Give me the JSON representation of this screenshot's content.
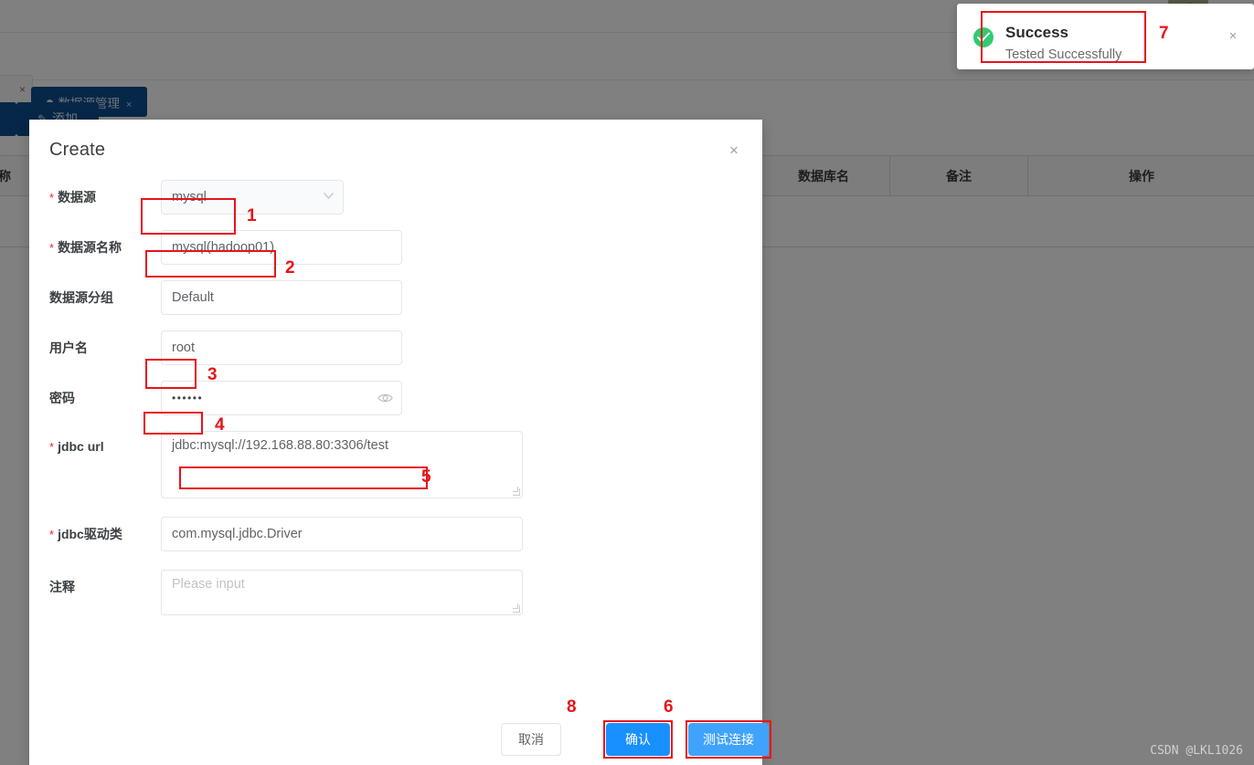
{
  "background": {
    "tab_partial_close": "×",
    "active_tab": {
      "label": "数据源管理",
      "close": "×"
    },
    "add_button": {
      "icon": "pencil-icon",
      "label": "添加"
    },
    "table": {
      "headers": [
        "称",
        "数据库名",
        "备注",
        "操作"
      ]
    }
  },
  "dialog": {
    "title": "Create",
    "close_icon": "×",
    "fields": [
      {
        "label": "数据源",
        "required": true,
        "type": "select",
        "value": "mysql",
        "icon": "chevron-down-icon"
      },
      {
        "label": "数据源名称",
        "required": true,
        "type": "text",
        "value": "mysql(hadoop01)"
      },
      {
        "label": "数据源分组",
        "required": false,
        "type": "text",
        "value": "Default"
      },
      {
        "label": "用户名",
        "required": false,
        "type": "text",
        "value": "root"
      },
      {
        "label": "密码",
        "required": false,
        "type": "password",
        "value": "••••••",
        "icon": "eye-icon"
      },
      {
        "label": "jdbc url",
        "required": true,
        "type": "textarea",
        "value": "jdbc:mysql://192.168.88.80:3306/test"
      },
      {
        "label": "jdbc驱动类",
        "required": true,
        "type": "text",
        "value": "com.mysql.jdbc.Driver"
      },
      {
        "label": "注释",
        "required": false,
        "type": "textarea",
        "value": "",
        "placeholder": "Please input"
      }
    ],
    "footer": {
      "cancel_label": "取消",
      "confirm_label": "确认",
      "test_label": "测试连接"
    }
  },
  "annotations": {
    "n1": "1",
    "n2": "2",
    "n3": "3",
    "n4": "4",
    "n5": "5",
    "n6": "6",
    "n7": "7",
    "n8": "8",
    "color": "#e8131a"
  },
  "toast": {
    "icon": "check-circle-icon",
    "title": "Success",
    "description": "Tested Successfully",
    "close_icon": "×",
    "accent_color": "#2ecc71"
  },
  "watermark": "CSDN @LKL1026",
  "theme": {
    "primary": "#1890ff",
    "test_button": "#40a3fb",
    "tab_blue": "#0d4e90",
    "required_star": "#f5222d",
    "mask": "rgba(0,0,0,0.5)"
  }
}
